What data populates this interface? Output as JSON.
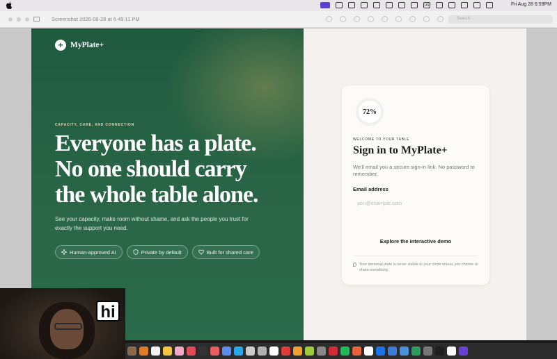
{
  "menubar": {
    "clock": "Fri Aug 28  6:59PM",
    "input_source": "US"
  },
  "window": {
    "title": "Screenshot 2026-08-28 at 6.49.11 PM",
    "search_placeholder": "Search"
  },
  "landing": {
    "brand": "MyPlate+",
    "eyebrow": "CAPACITY, CARE, AND CONNECTION",
    "headline_lines": [
      "Everyone has a plate.",
      "No one should carry",
      "the whole table alone."
    ],
    "subtitle": "See your capacity, make room without shame, and ask the people you trust for exactly the support you need.",
    "chips": [
      {
        "label": "Human-approved AI",
        "icon": "sparkle-icon"
      },
      {
        "label": "Private by default",
        "icon": "shield-icon"
      },
      {
        "label": "Built for shared care",
        "icon": "heart-icon"
      }
    ]
  },
  "signin": {
    "capacity_percent": "72%",
    "eyebrow": "WELCOME TO YOUR TABLE",
    "title": "Sign in to MyPlate+",
    "description": "We'll email you a secure sign-in link. No password to remember.",
    "email_label": "Email address",
    "email_placeholder": "you@example.com",
    "demo_link": "Explore the interactive demo",
    "privacy_note": "Your personal plate is never visible to your circle unless you choose to share something."
  },
  "webcam": {
    "overlay_text": "hi"
  },
  "colors": {
    "brand_green": "#1f5a3f",
    "cream": "#f5f1ee",
    "accent_gold": "#e7d8b6"
  },
  "dock_apps": [
    "#8a6a4a",
    "#e07b2a",
    "#f3f3f3",
    "#f6c443",
    "#f5a8c6",
    "#e64a5a",
    "#333333",
    "#e85d5d",
    "#5b8def",
    "#2aa5e8",
    "#cccccc",
    "#b0b0b0",
    "#ffffff",
    "#e03b3b",
    "#f0a030",
    "#9ccc3a",
    "#888888",
    "#d12b3a",
    "#1db954",
    "#e8613a",
    "#ffffff",
    "#1a73e8",
    "#3d7bd9",
    "#4a90d9",
    "#2a9d5c",
    "#777777",
    "#1f1f1f",
    "#ffffff",
    "#6a3fd6"
  ]
}
